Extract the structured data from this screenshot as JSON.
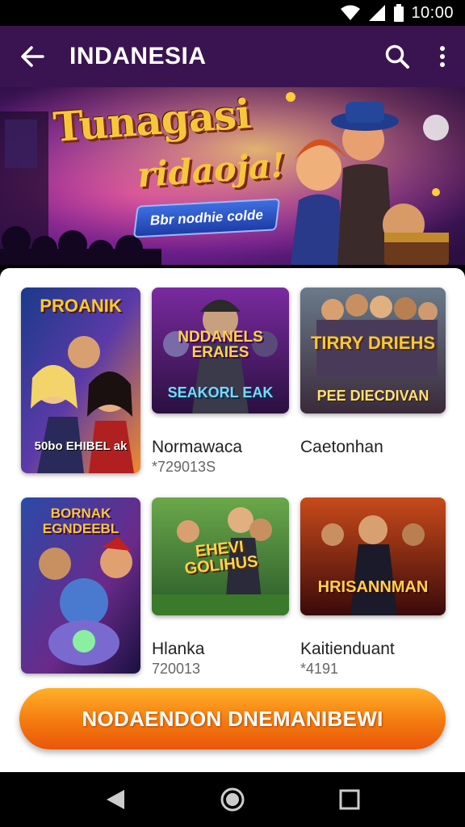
{
  "status_bar": {
    "time": "10:00",
    "icons": [
      "wifi-icon",
      "signal-icon",
      "battery-icon"
    ]
  },
  "app_bar": {
    "title": "INDANESIA",
    "back_icon": "back-arrow-icon",
    "search_icon": "search-icon",
    "more_icon": "more-vert-icon"
  },
  "banner": {
    "title_line1": "Tunagasi",
    "title_line2": "ridaoja!",
    "pill_text": "Bbr nodhie colde"
  },
  "games": [
    {
      "card_text_top": "PROANIK",
      "card_text_bottom": "50bo EHIBEL ak",
      "name": "",
      "meta": ""
    },
    {
      "card_text_top": "NDDANELS ERAIES",
      "card_text_bottom": "SEAKORL EAK",
      "name": "Normawaca",
      "meta": "*729013S"
    },
    {
      "card_text_top": "TIRRY DRIEHS",
      "card_text_bottom": "PEE DIECDIVAN",
      "name": "Caetonhan",
      "meta": ""
    },
    {
      "card_text_top": "BORNAK EGNDEEBL",
      "card_text_bottom": "",
      "name": "",
      "meta": ""
    },
    {
      "card_text_top": "EHEVI GOLIHUS",
      "card_text_bottom": "",
      "name": "Hlanka",
      "meta": "720013"
    },
    {
      "card_text_top": "HRISANNMAN",
      "card_text_bottom": "",
      "name": "Kaitienduant",
      "meta": "*4191"
    }
  ],
  "cta": {
    "label": "NODAENDON DNEMANIBEWI"
  },
  "nav_bar": {
    "back": "nav-back-icon",
    "home": "nav-home-icon",
    "recents": "nav-recents-icon"
  },
  "colors": {
    "app_bar": "#3a1450",
    "cta_top": "#ffb02a",
    "cta_bottom": "#e9560a",
    "sheet": "#ffffff"
  }
}
